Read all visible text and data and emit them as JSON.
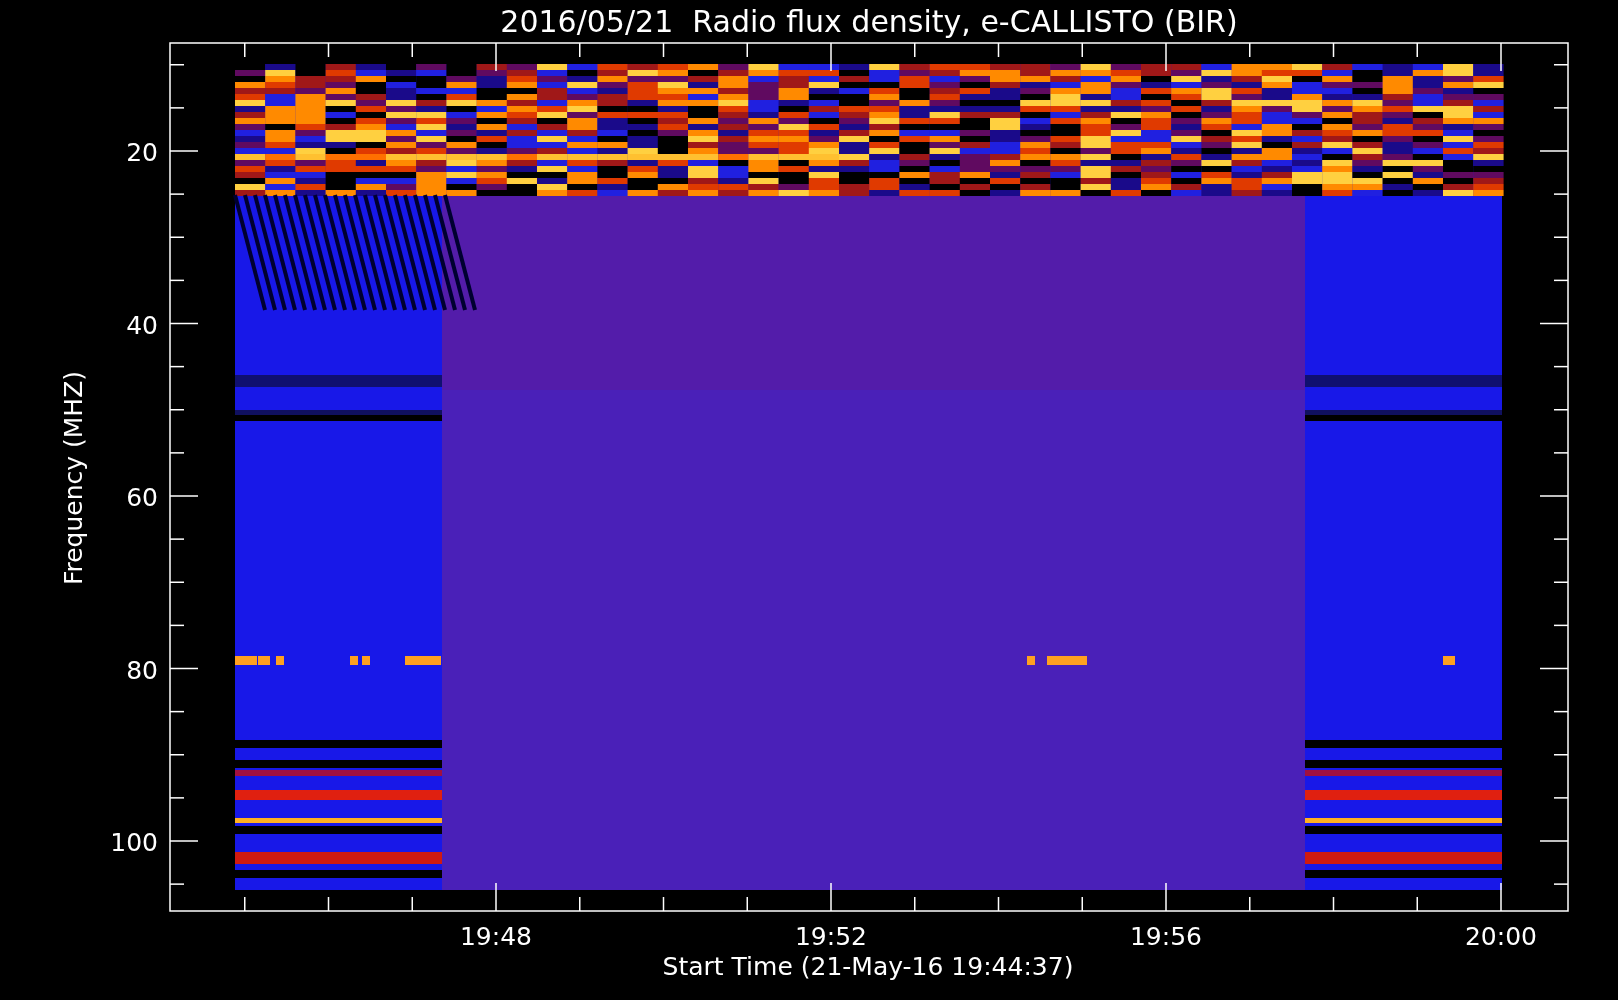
{
  "title": "2016/05/21  Radio flux density, e-CALLISTO (BIR)",
  "y_axis": {
    "label": "Frequency (MHZ)",
    "ticks": [
      "20",
      "40",
      "60",
      "80",
      "100"
    ]
  },
  "x_axis": {
    "label": "Start Time (21-May-16 19:44:37)",
    "ticks": [
      "19:48",
      "19:52",
      "19:56",
      "20:00"
    ]
  }
}
